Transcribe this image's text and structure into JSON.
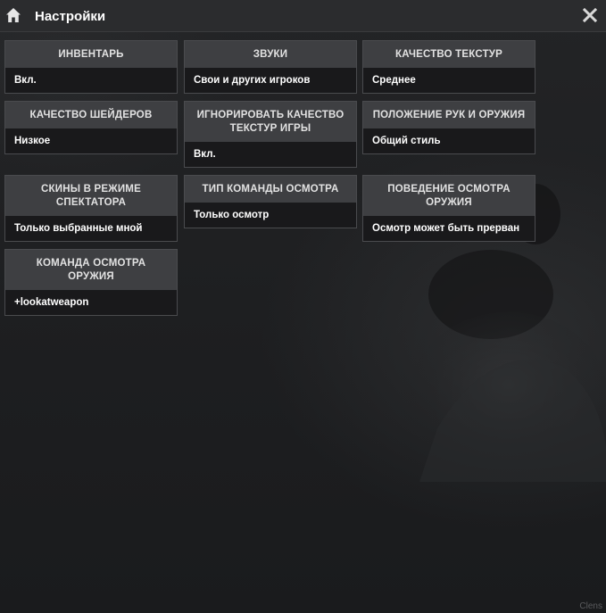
{
  "window": {
    "title": "Настройки",
    "close_icon": "close-icon",
    "home_icon": "home-icon",
    "accent_color": "#ffffff"
  },
  "settings": [
    {
      "label": "ИНВЕНТАРЬ",
      "value": "Вкл."
    },
    {
      "label": "ЗВУКИ",
      "value": "Свои и других игроков"
    },
    {
      "label": "КАЧЕСТВО ТЕКСТУР",
      "value": "Среднее"
    },
    {
      "label": "КАЧЕСТВО ШЕЙДЕРОВ",
      "value": "Низкое"
    },
    {
      "label": "ИГНОРИРОВАТЬ КАЧЕСТВО ТЕКСТУР ИГРЫ",
      "value": "Вкл."
    },
    {
      "label": "ПОЛОЖЕНИЕ РУК И ОРУЖИЯ",
      "value": "Общий стиль"
    },
    {
      "label": "СКИНЫ В РЕЖИМЕ СПЕКТАТОРА",
      "value": "Только выбранные мной"
    },
    {
      "label": "ТИП КОМАНДЫ ОСМОТРА",
      "value": "Только осмотр"
    },
    {
      "label": "ПОВЕДЕНИЕ ОСМОТРА ОРУЖИЯ",
      "value": "Осмотр может быть прерван"
    },
    {
      "label": "КОМАНДА ОСМОТРА ОРУЖИЯ",
      "value": "+lookatweapon"
    }
  ],
  "watermark": "Clens"
}
